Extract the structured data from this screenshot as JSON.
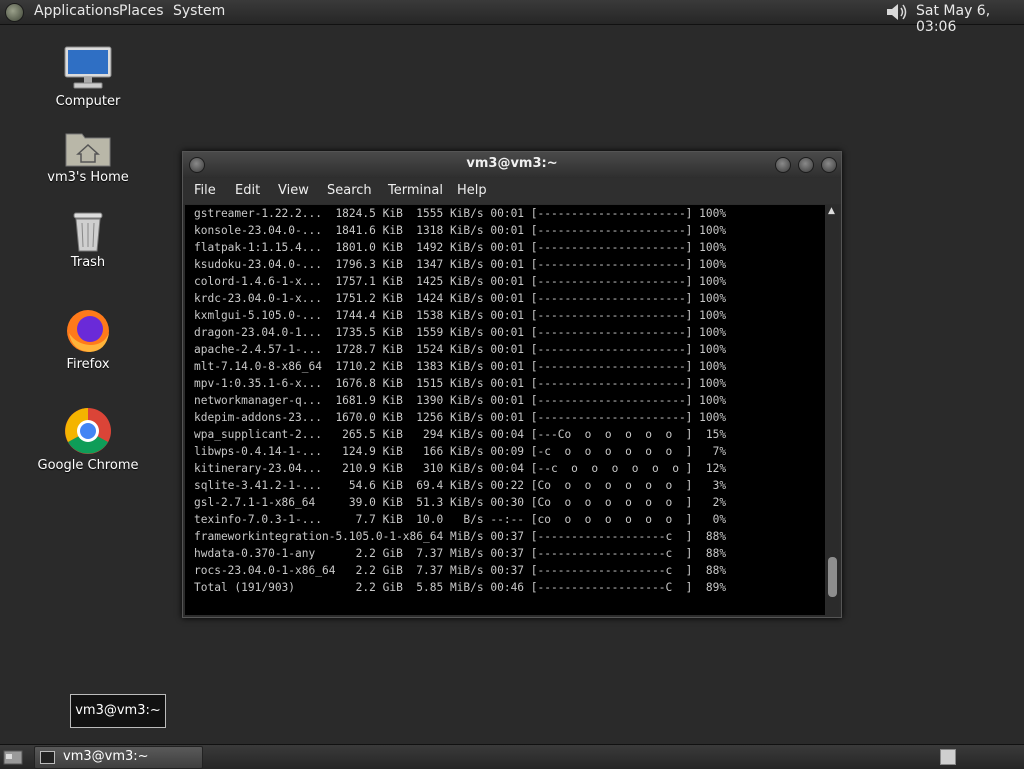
{
  "top_panel": {
    "menus": [
      "Applications",
      "Places",
      "System"
    ],
    "clock": "Sat May  6, 03:06"
  },
  "desktop_icons": [
    {
      "label": "Computer",
      "icon": "computer-icon"
    },
    {
      "label": "vm3's Home",
      "icon": "home-folder-icon"
    },
    {
      "label": "Trash",
      "icon": "trash-icon"
    },
    {
      "label": "Firefox",
      "icon": "firefox-icon"
    },
    {
      "label": "Google Chrome",
      "icon": "chrome-icon"
    }
  ],
  "terminal": {
    "title": "vm3@vm3:~",
    "menu": [
      "File",
      "Edit",
      "View",
      "Search",
      "Terminal",
      "Help"
    ],
    "lines": [
      "gstreamer-1.22.2...  1824.5 KiB  1555 KiB/s 00:01 [----------------------] 100%",
      "konsole-23.04.0-...  1841.6 KiB  1318 KiB/s 00:01 [----------------------] 100%",
      "flatpak-1:1.15.4...  1801.0 KiB  1492 KiB/s 00:01 [----------------------] 100%",
      "ksudoku-23.04.0-...  1796.3 KiB  1347 KiB/s 00:01 [----------------------] 100%",
      "colord-1.4.6-1-x...  1757.1 KiB  1425 KiB/s 00:01 [----------------------] 100%",
      "krdc-23.04.0-1-x...  1751.2 KiB  1424 KiB/s 00:01 [----------------------] 100%",
      "kxmlgui-5.105.0-...  1744.4 KiB  1538 KiB/s 00:01 [----------------------] 100%",
      "dragon-23.04.0-1...  1735.5 KiB  1559 KiB/s 00:01 [----------------------] 100%",
      "apache-2.4.57-1-...  1728.7 KiB  1524 KiB/s 00:01 [----------------------] 100%",
      "mlt-7.14.0-8-x86_64  1710.2 KiB  1383 KiB/s 00:01 [----------------------] 100%",
      "mpv-1:0.35.1-6-x...  1676.8 KiB  1515 KiB/s 00:01 [----------------------] 100%",
      "networkmanager-q...  1681.9 KiB  1390 KiB/s 00:01 [----------------------] 100%",
      "kdepim-addons-23...  1670.0 KiB  1256 KiB/s 00:01 [----------------------] 100%",
      "wpa_supplicant-2...   265.5 KiB   294 KiB/s 00:04 [---Co  o  o  o  o  o  ]  15%",
      "libwps-0.4.14-1-...   124.9 KiB   166 KiB/s 00:09 [-c  o  o  o  o  o  o  ]   7%",
      "kitinerary-23.04...   210.9 KiB   310 KiB/s 00:04 [--c  o  o  o  o  o  o ]  12%",
      "sqlite-3.41.2-1-...    54.6 KiB  69.4 KiB/s 00:22 [Co  o  o  o  o  o  o  ]   3%",
      "gsl-2.7.1-1-x86_64     39.0 KiB  51.3 KiB/s 00:30 [Co  o  o  o  o  o  o  ]   2%",
      "texinfo-7.0.3-1-...     7.7 KiB  10.0   B/s --:-- [co  o  o  o  o  o  o  ]   0%",
      "frameworkintegration-5.105.0-1-x86_64 MiB/s 00:37 [-------------------c  ]  88%",
      "hwdata-0.370-1-any      2.2 GiB  7.37 MiB/s 00:37 [-------------------c  ]  88%",
      "rocs-23.04.0-1-x86_64   2.2 GiB  7.37 MiB/s 00:37 [-------------------c  ]  88%",
      "Total (191/903)         2.2 GiB  5.85 MiB/s 00:46 [-------------------C  ]  89%"
    ]
  },
  "tooltip": "vm3@vm3:~",
  "taskbar": {
    "window_label": "vm3@vm3:~"
  }
}
